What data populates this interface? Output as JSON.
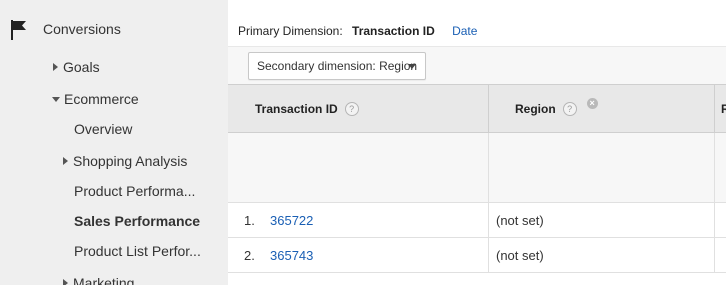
{
  "sidebar": {
    "conversions": "Conversions",
    "goals": "Goals",
    "ecommerce": "Ecommerce",
    "overview": "Overview",
    "shopping_analysis": "Shopping Analysis",
    "product_performance": "Product Performa...",
    "sales_performance": "Sales Performance",
    "product_list_performance": "Product List Perfor...",
    "marketing": "Marketing"
  },
  "main": {
    "primary_dimension_label": "Primary Dimension:",
    "primary_dimension_active": "Transaction ID",
    "primary_dimension_link": "Date",
    "secondary_dimension": "Secondary dimension: Region",
    "columns": {
      "transaction_id": "Transaction ID",
      "region": "Region",
      "next": "R"
    },
    "help_glyph": "?",
    "remove_glyph": "×",
    "rows": [
      {
        "index": "1.",
        "transaction_id": "365722",
        "region": "(not set)"
      },
      {
        "index": "2.",
        "transaction_id": "365743",
        "region": "(not set)"
      }
    ]
  },
  "colors": {
    "sidebar_bg": "#efefef",
    "link": "#1a5fb4",
    "header_bg": "#e8e8e8"
  },
  "icons": [
    "flag-icon",
    "triangle-right-icon",
    "triangle-down-icon",
    "help-icon",
    "remove-icon",
    "caret-down-icon"
  ]
}
